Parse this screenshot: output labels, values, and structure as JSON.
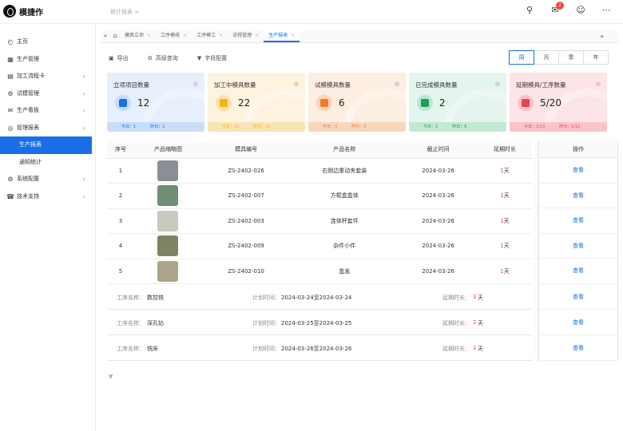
{
  "app": {
    "title": "模捷作",
    "breadcrumb": "统计报表 >"
  },
  "header": {
    "notification_count": "2"
  },
  "sidebar": {
    "items": [
      {
        "label": "主页",
        "icon": "dashboard-icon",
        "chevron": false,
        "sub": false,
        "active": false
      },
      {
        "label": "生产管理",
        "icon": "factory-icon",
        "chevron": false,
        "sub": false,
        "active": false
      },
      {
        "label": "加工流程卡",
        "icon": "card-icon",
        "chevron": true,
        "sub": false,
        "active": false
      },
      {
        "label": "试模管理",
        "icon": "mold-icon",
        "chevron": true,
        "sub": false,
        "active": false
      },
      {
        "label": "生产看板",
        "icon": "mail-icon",
        "chevron": true,
        "sub": false,
        "active": false
      },
      {
        "label": "管理报表",
        "icon": "report-icon",
        "chevron": true,
        "sub": false,
        "active": false
      },
      {
        "label": "生产报表",
        "icon": "",
        "chevron": false,
        "sub": true,
        "active": true
      },
      {
        "label": "通知统计",
        "icon": "",
        "chevron": false,
        "sub": true,
        "active": false
      },
      {
        "label": "系统配置",
        "icon": "settings-icon",
        "chevron": true,
        "sub": false,
        "active": false
      },
      {
        "label": "技术支持",
        "icon": "support-icon",
        "chevron": true,
        "sub": false,
        "active": false
      }
    ]
  },
  "tabs": [
    {
      "label": "模具立项",
      "active": false
    },
    {
      "label": "工序模排",
      "active": false
    },
    {
      "label": "工序模工",
      "active": false
    },
    {
      "label": "流程管理",
      "active": false
    },
    {
      "label": "生产报表",
      "active": true
    }
  ],
  "toolbar": {
    "export": "导出",
    "filter": "高级查询",
    "settings": "字段配置"
  },
  "period": [
    "周",
    "月",
    "季",
    "年"
  ],
  "cards": [
    {
      "title": "立项项目数量",
      "value": "12",
      "today": "今日：1",
      "week": "昨日：1",
      "bg": "#e7effd",
      "foot": "#c9dcfa",
      "bubble": "#c8dcfb",
      "accent": "#1a6fe8"
    },
    {
      "title": "加工中模具数量",
      "value": "22",
      "today": "今日：11",
      "week": "昨日：12",
      "bg": "#fdf3df",
      "foot": "#f9e4b4",
      "bubble": "#fbe2a8",
      "accent": "#f2b01e"
    },
    {
      "title": "试模模具数量",
      "value": "6",
      "today": "今日：3",
      "week": "昨日：3",
      "bg": "#fdeee2",
      "foot": "#f8d6bc",
      "bubble": "#fad3b3",
      "accent": "#f07a22"
    },
    {
      "title": "已完成模具数量",
      "value": "2",
      "today": "今日：1",
      "week": "昨日：6",
      "bg": "#e3f5ec",
      "foot": "#c1e9d3",
      "bubble": "#b9e6cd",
      "accent": "#1f9a5c"
    },
    {
      "title": "延期模具/工序数量",
      "value": "5/20",
      "today": "今日：1/13",
      "week": "昨日：1/11",
      "bg": "#fde4e6",
      "foot": "#f8c4c9",
      "bubble": "#f9c2c8",
      "accent": "#e04654"
    }
  ],
  "table": {
    "headers": [
      "序号",
      "产品缩略图",
      "模具编号",
      "产品名称",
      "截止时间",
      "延期时长"
    ],
    "op_header": "操作",
    "op_label": "查看",
    "rows": [
      {
        "no": "1",
        "code": "ZS-2402-026",
        "name": "右侧边重动夹套装",
        "deadline": "2024-03-26",
        "delay": "1",
        "unit": "天",
        "thumb": "#8a8f96"
      },
      {
        "no": "2",
        "code": "ZS-2402-007",
        "name": "方框盒盒体",
        "deadline": "2024-03-26",
        "delay": "1",
        "unit": "天",
        "thumb": "#6f8f74"
      },
      {
        "no": "3",
        "code": "ZS-2402-003",
        "name": "连体杯套件",
        "deadline": "2024-03-26",
        "delay": "1",
        "unit": "天",
        "thumb": "#c9c9bd"
      },
      {
        "no": "4",
        "code": "ZS-2402-009",
        "name": "杂件小件",
        "deadline": "2024-03-26",
        "delay": "1",
        "unit": "天",
        "thumb": "#7d8461"
      },
      {
        "no": "5",
        "code": "ZS-2402-010",
        "name": "盒盖",
        "deadline": "2024-03-26",
        "delay": "1",
        "unit": "天",
        "thumb": "#b0a48a"
      }
    ],
    "process_rows": [
      {
        "label": "工序名称：",
        "name": "数控铣",
        "plan_label": "计划时间：",
        "plan": "2024-03-24至2024-03-24",
        "delay_label": "延期时长：",
        "delay": "3",
        "unit": "天"
      },
      {
        "label": "工序名称：",
        "name": "深孔钻",
        "plan_label": "计划时间：",
        "plan": "2024-03-25至2024-03-25",
        "delay_label": "延期时长：",
        "delay": "2",
        "unit": "天"
      },
      {
        "label": "工序名称：",
        "name": "铣床",
        "plan_label": "计划时间：",
        "plan": "2024-03-26至2024-03-26",
        "delay_label": "延期时长：",
        "delay": "1",
        "unit": "天"
      }
    ]
  }
}
